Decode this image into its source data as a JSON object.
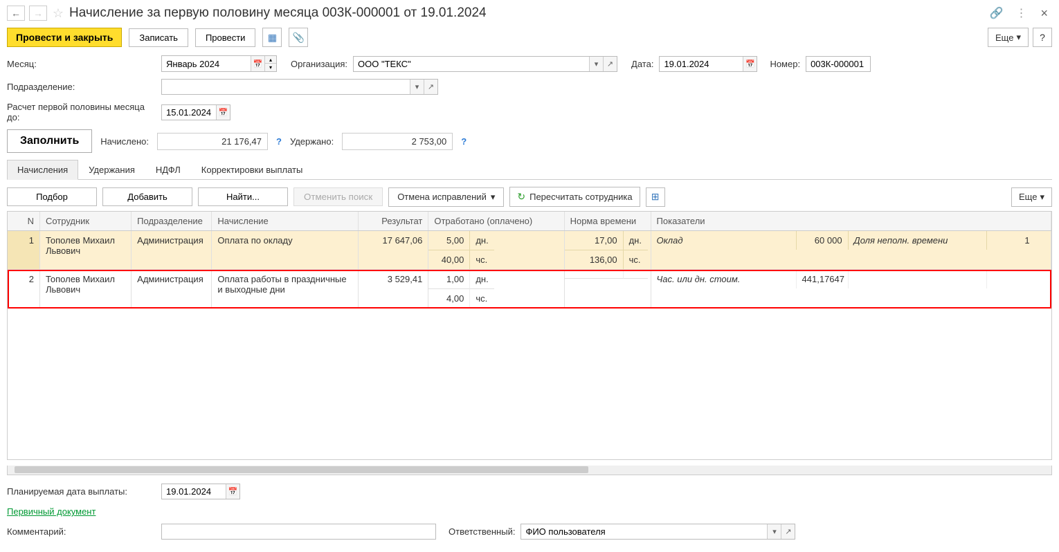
{
  "title": "Начисление за первую половину месяца 003К-000001 от 19.01.2024",
  "toolbar": {
    "primary": "Провести и закрыть",
    "save": "Записать",
    "post": "Провести",
    "more": "Еще"
  },
  "fields": {
    "month_label": "Месяц:",
    "month_value": "Январь 2024",
    "org_label": "Организация:",
    "org_value": "ООО \"ТЕКС\"",
    "date_label": "Дата:",
    "date_value": "19.01.2024",
    "number_label": "Номер:",
    "number_value": "003К-000001",
    "dept_label": "Подразделение:",
    "dept_value": "",
    "calc_till_label": "Расчет первой половины месяца до:",
    "calc_till_value": "15.01.2024",
    "fill_btn": "Заполнить",
    "accrued_label": "Начислено:",
    "accrued_value": "21 176,47",
    "withheld_label": "Удержано:",
    "withheld_value": "2 753,00",
    "planned_date_label": "Планируемая дата выплаты:",
    "planned_date_value": "19.01.2024",
    "primary_doc": "Первичный документ",
    "comment_label": "Комментарий:",
    "comment_value": "",
    "responsible_label": "Ответственный:",
    "responsible_value": "ФИО пользователя"
  },
  "tabs": {
    "t1": "Начисления",
    "t2": "Удержания",
    "t3": "НДФЛ",
    "t4": "Корректировки выплаты"
  },
  "table_toolbar": {
    "pick": "Подбор",
    "add": "Добавить",
    "find": "Найти...",
    "cancel_search": "Отменить поиск",
    "cancel_fixes": "Отмена исправлений",
    "recalc": "Пересчитать сотрудника",
    "more": "Еще"
  },
  "columns": {
    "n": "N",
    "emp": "Сотрудник",
    "dept": "Подразделение",
    "accr": "Начисление",
    "res": "Результат",
    "worked": "Отработано (оплачено)",
    "norm": "Норма времени",
    "ind": "Показатели"
  },
  "rows": [
    {
      "n": "1",
      "emp": "Тополев Михаил Львович",
      "dept": "Администрация",
      "accr": "Оплата по окладу",
      "res": "17 647,06",
      "worked_d": "5,00",
      "worked_du": "дн.",
      "worked_h": "40,00",
      "worked_hu": "чс.",
      "norm_d": "17,00",
      "norm_du": "дн.",
      "norm_h": "136,00",
      "norm_hu": "чс.",
      "ind1_name": "Оклад",
      "ind1_val": "60 000",
      "ind2_name": "Доля неполн. времени",
      "ind2_val": "1"
    },
    {
      "n": "2",
      "emp": "Тополев Михаил Львович",
      "dept": "Администрация",
      "accr": "Оплата работы в праздничные и выходные дни",
      "res": "3 529,41",
      "worked_d": "1,00",
      "worked_du": "дн.",
      "worked_h": "4,00",
      "worked_hu": "чс.",
      "norm_d": "",
      "norm_du": "",
      "norm_h": "",
      "norm_hu": "",
      "ind1_name": "Час. или дн. стоим.",
      "ind1_val": "441,17647",
      "ind2_name": "",
      "ind2_val": ""
    }
  ]
}
